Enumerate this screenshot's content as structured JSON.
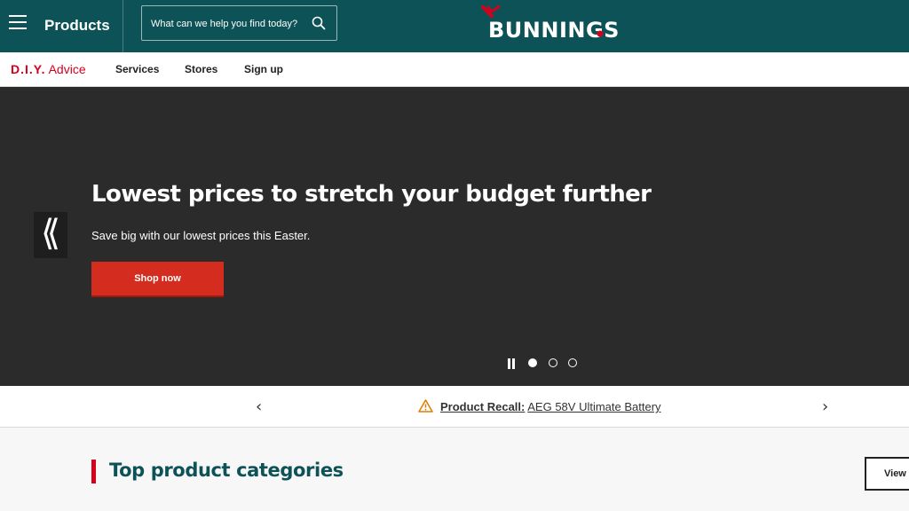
{
  "header": {
    "products_label": "Products",
    "search": {
      "placeholder": "What can we help you find today?"
    },
    "logo_text": "BUNNINGS"
  },
  "subnav": {
    "diy_strong": "D.I.Y.",
    "diy_light": "Advice",
    "links": [
      "Services",
      "Stores",
      "Sign up"
    ]
  },
  "hero": {
    "prev_glyph": "⟪",
    "title": "Lowest prices to stretch your budget further",
    "subtitle": "Save big with our lowest prices this Easter.",
    "cta": "Shop now",
    "slides_total": 3,
    "active_slide": 1
  },
  "recall": {
    "prev_glyph": "‹",
    "next_glyph": "›",
    "label": "Product Recall:",
    "item": "AEG 58V Ultimate Battery"
  },
  "categories": {
    "title": "Top product categories",
    "view_label": "View"
  },
  "colors": {
    "brand_teal": "#0d5257",
    "brand_red": "#d6001c",
    "cta_red": "#d42c1e",
    "hero_bg": "#2b2b2b",
    "warning_orange": "#e07b00"
  }
}
